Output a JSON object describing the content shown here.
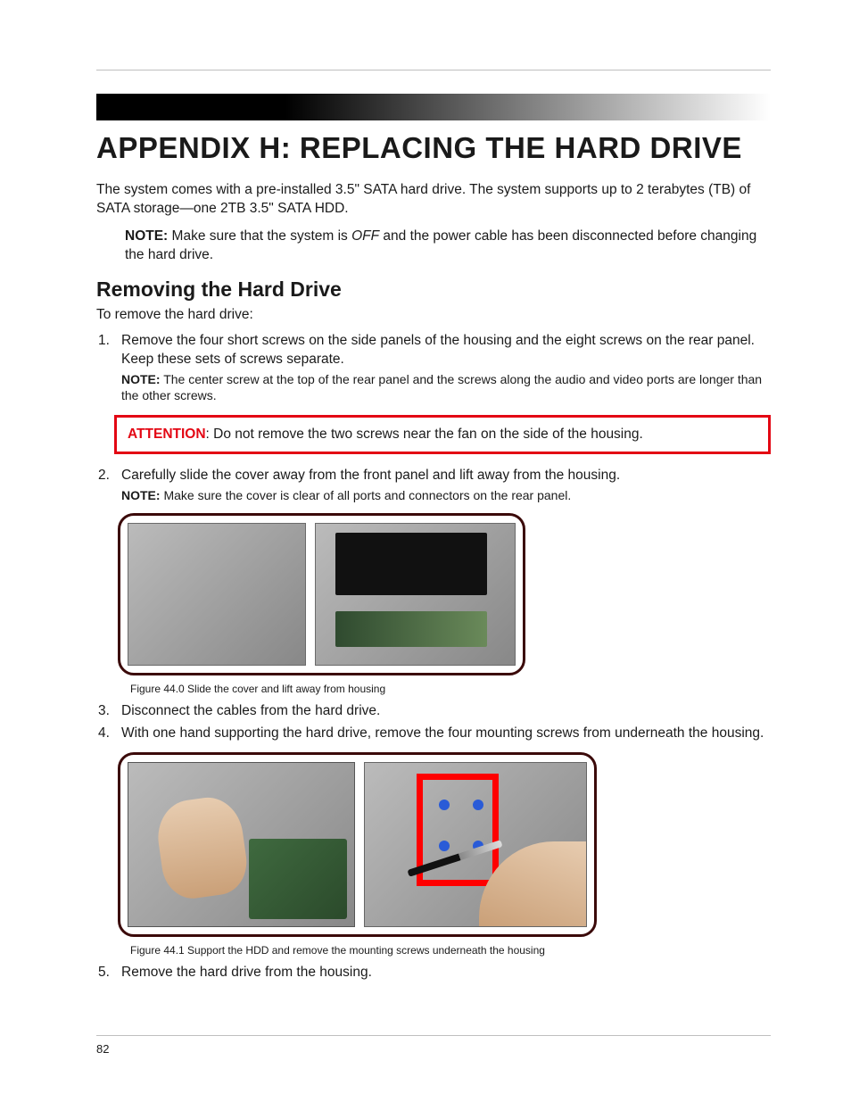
{
  "page_number": "82",
  "title": "APPENDIX H: REPLACING THE HARD DRIVE",
  "intro": "The system comes with a pre-installed 3.5\" SATA hard drive. The system supports up to 2 terabytes (TB) of SATA storage—one 2TB 3.5\" SATA HDD.",
  "top_note": {
    "label": "NOTE:",
    "before_off": "Make sure that the system is ",
    "off_word": "OFF",
    "after_off": " and the power cable has been disconnected before changing the hard drive."
  },
  "subhead": "Removing the Hard Drive",
  "lead": "To remove the hard drive:",
  "steps": {
    "s1": {
      "num": "1.",
      "text": "Remove the four short screws on the side panels of the housing and the eight screws on the rear panel. Keep these sets of screws separate.",
      "note_label": "NOTE:",
      "note_text": " The center screw at the top of the rear panel and the screws along the audio and video ports are longer than the other screws."
    },
    "attention": {
      "label": "ATTENTION",
      "text": ": Do not remove the two screws near the fan on the side of the housing."
    },
    "s2": {
      "num": "2.",
      "text": "Carefully slide the cover away from the front panel and lift away from the housing.",
      "note_label": "NOTE:",
      "note_text": " Make sure the cover is clear of all ports and connectors on the rear panel."
    },
    "fig1_caption": "Figure 44.0 Slide the cover and lift away from housing",
    "s3": {
      "num": "3.",
      "text": "Disconnect the cables from the hard drive."
    },
    "s4": {
      "num": "4.",
      "text": "With one hand supporting the hard drive, remove the four mounting screws from underneath the housing."
    },
    "fig2_caption": "Figure 44.1 Support the HDD and remove the mounting screws underneath the housing",
    "s5": {
      "num": "5.",
      "text": "Remove the hard drive from the housing."
    }
  }
}
